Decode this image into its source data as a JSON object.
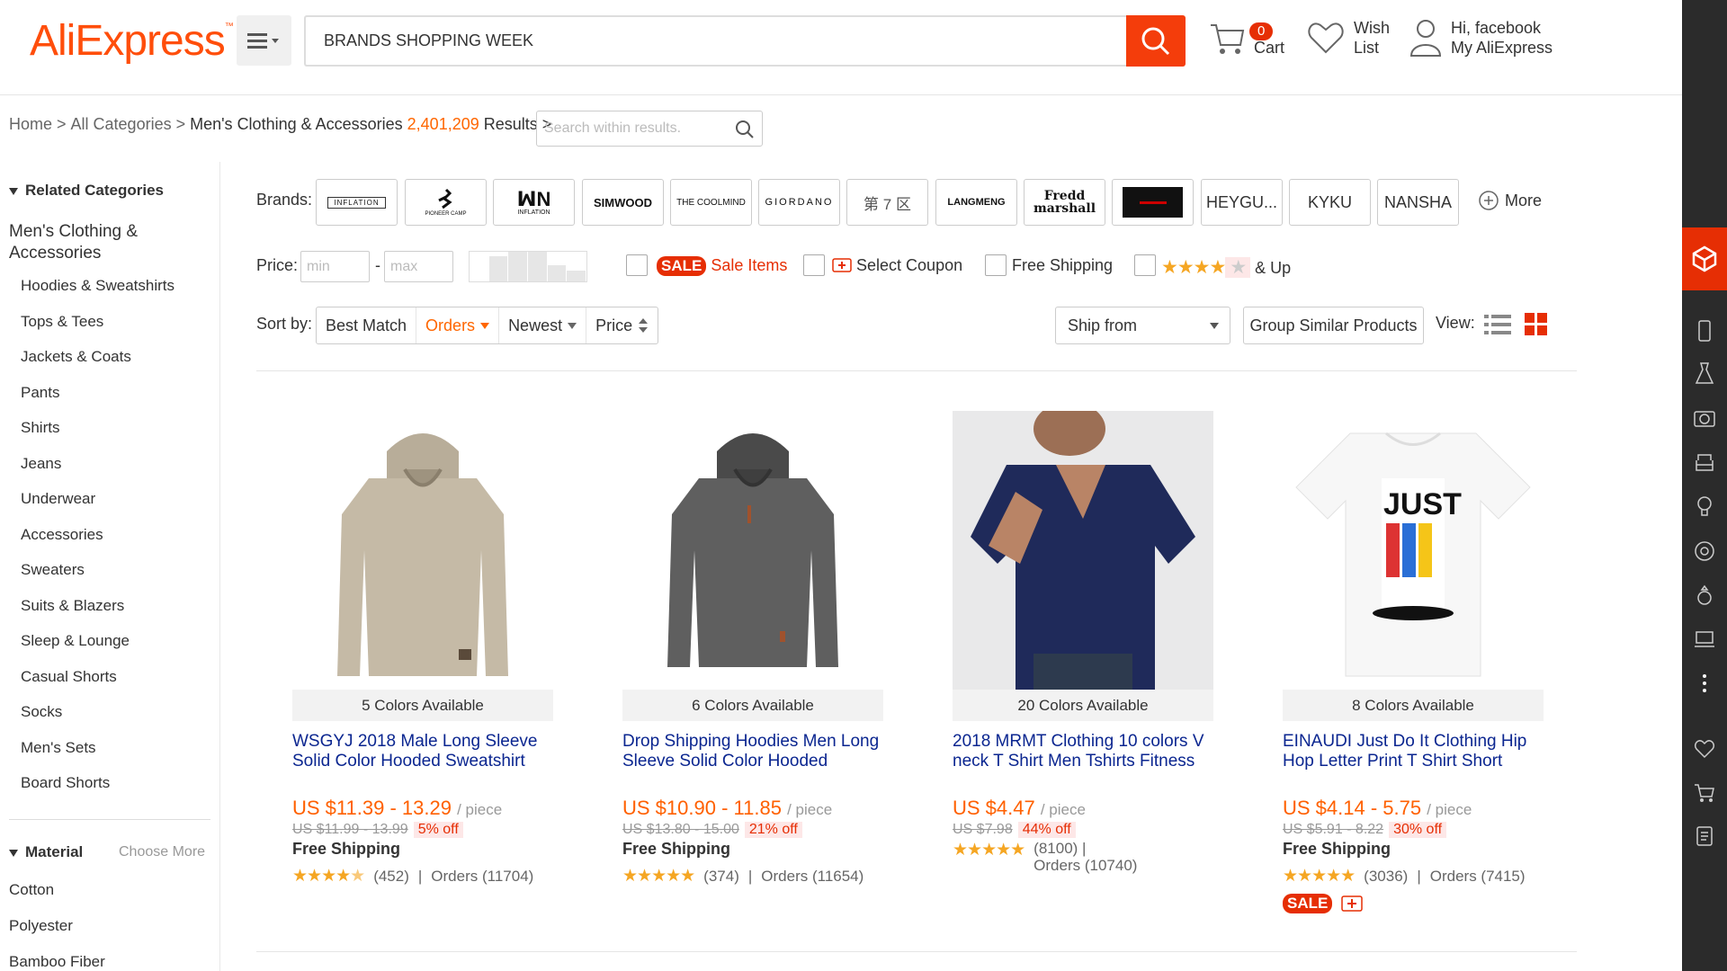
{
  "header": {
    "logo": "AliExpress",
    "search_value": "BRANDS SHOPPING WEEK",
    "cart_count": "0",
    "cart_label": "Cart",
    "wish_line1": "Wish",
    "wish_line2": "List",
    "account_line1": "Hi, facebook",
    "account_line2": "My AliExpress"
  },
  "breadcrumb": {
    "home": "Home",
    "all": "All Categories",
    "current": "Men's Clothing & Accessories",
    "count": "2,401,209",
    "results": "Results",
    "search_placeholder": "Search within results."
  },
  "sidebar": {
    "related_title": "Related Categories",
    "main_category": "Men's Clothing & Accessories",
    "items": [
      "Hoodies & Sweatshirts",
      "Tops & Tees",
      "Jackets & Coats",
      "Pants",
      "Shirts",
      "Jeans",
      "Underwear",
      "Accessories",
      "Sweaters",
      "Suits & Blazers",
      "Sleep & Lounge",
      "Casual Shorts",
      "Socks",
      "Men's Sets",
      "Board Shorts"
    ],
    "material_title": "Material",
    "choose_more": "Choose More",
    "materials": [
      "Cotton",
      "Polyester",
      "Bamboo Fiber"
    ]
  },
  "filters": {
    "brands_label": "Brands:",
    "brands": [
      "INFLATION",
      "PIONEER CAMP",
      "INFLATION",
      "SIMWOOD",
      "THE COOLMIND",
      "GIORDANO",
      "第 7 区",
      "LANGMENG",
      "Fredd marshall",
      "",
      "HEYGU...",
      "KYKU",
      "NANSHA"
    ],
    "more": "More",
    "price_label": "Price:",
    "min_placeholder": "min",
    "max_placeholder": "max",
    "sale_tag": "SALE",
    "sale_items": "Sale Items",
    "select_coupon": "Select Coupon",
    "free_shipping": "Free Shipping",
    "and_up": "& Up",
    "sort_label": "Sort by:",
    "sort": [
      "Best Match",
      "Orders",
      "Newest",
      "Price"
    ],
    "ship_from": "Ship from",
    "group": "Group Similar Products",
    "view_label": "View:"
  },
  "products": [
    {
      "colors": "5 Colors Available",
      "title": "WSGYJ 2018 Male Long Sleeve Solid Color Hooded Sweatshirt",
      "price": "US $11.39 - 13.29",
      "unit": "/ piece",
      "orig": "US $11.99 - 13.99",
      "off": "5% off",
      "shipping": "Free Shipping",
      "reviews": "(452)",
      "orders": "Orders (11704)",
      "rating": 4.5
    },
    {
      "colors": "6 Colors Available",
      "title": "Drop Shipping Hoodies Men Long Sleeve Solid Color Hooded",
      "price": "US $10.90 - 11.85",
      "unit": "/ piece",
      "orig": "US $13.80 - 15.00",
      "off": "21% off",
      "shipping": "Free Shipping",
      "reviews": "(374)",
      "orders": "Orders (11654)",
      "rating": 5
    },
    {
      "colors": "20 Colors Available",
      "title": "2018 MRMT Clothing 10 colors V neck T Shirt Men Tshirts Fitness",
      "price": "US $4.47",
      "unit": "/ piece",
      "orig": "US $7.98",
      "off": "44% off",
      "shipping": "",
      "reviews": "(8100) |",
      "orders": "Orders (10740)",
      "rating": 5
    },
    {
      "colors": "8 Colors Available",
      "title": "EINAUDI Just Do It Clothing Hip Hop Letter Print T Shirt Short",
      "price": "US $4.14 - 5.75",
      "unit": "/ piece",
      "orig": "US $5.91 - 8.22",
      "off": "30% off",
      "shipping": "Free Shipping",
      "reviews": "(3036)",
      "orders": "Orders (7415)",
      "rating": 5
    }
  ],
  "colors": {
    "brand": "#ff4e0b",
    "accent": "#f43d0b",
    "price": "#ff6000",
    "link": "#0b2690",
    "sale": "#e62e04"
  }
}
